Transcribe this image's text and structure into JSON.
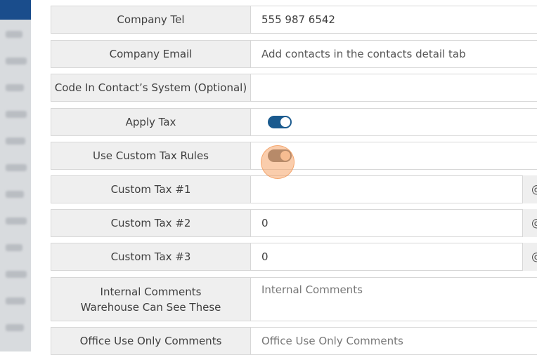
{
  "form": {
    "rows": {
      "company_tel": {
        "label": "Company Tel",
        "value": "555 987 6542"
      },
      "company_email": {
        "label": "Company Email",
        "value": "Add contacts in the contacts detail tab"
      },
      "code_in_contact_system": {
        "label": "Code In Contact’s System (Optional)",
        "value": ""
      },
      "apply_tax": {
        "label": "Apply Tax",
        "state": "on"
      },
      "use_custom_tax_rules": {
        "label": "Use Custom Tax Rules",
        "state": "off"
      },
      "custom_tax_1": {
        "label": "Custom Tax #1",
        "value": "",
        "addon": "@"
      },
      "custom_tax_2": {
        "label": "Custom Tax #2",
        "value": "0",
        "addon": "@"
      },
      "custom_tax_3": {
        "label": "Custom Tax #3",
        "value": "0",
        "addon": "@"
      },
      "internal_comments": {
        "label_line1": "Internal Comments",
        "label_line2": "Warehouse Can See These",
        "placeholder": "Internal Comments"
      },
      "office_use_only": {
        "label": "Office Use Only Comments",
        "placeholder": "Office Use Only Comments"
      }
    }
  },
  "colors": {
    "toggle_on": "#1a5a8e",
    "toggle_off": "#6a6a6a",
    "label_bg": "#efefef",
    "sidebar_top": "#1a4d8c"
  }
}
